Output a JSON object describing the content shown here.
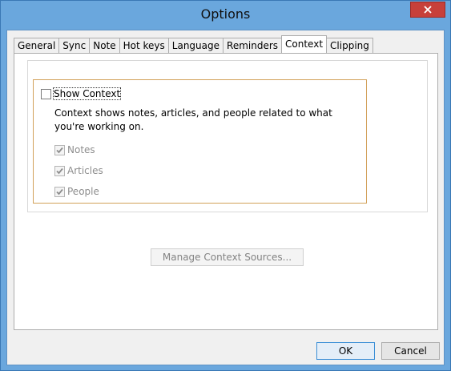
{
  "window": {
    "title": "Options"
  },
  "tabs": [
    {
      "label": "General"
    },
    {
      "label": "Sync"
    },
    {
      "label": "Note"
    },
    {
      "label": "Hot keys"
    },
    {
      "label": "Language"
    },
    {
      "label": "Reminders"
    },
    {
      "label": "Context"
    },
    {
      "label": "Clipping"
    }
  ],
  "active_tab": "Context",
  "context": {
    "show_context": {
      "label": "Show Context",
      "checked": false
    },
    "description": "Context shows notes, articles, and people related to what you're working on.",
    "sources": [
      {
        "label": "Notes",
        "checked": true,
        "enabled": false
      },
      {
        "label": "Articles",
        "checked": true,
        "enabled": false
      },
      {
        "label": "People",
        "checked": true,
        "enabled": false
      }
    ],
    "manage_label": "Manage Context Sources..."
  },
  "footer": {
    "ok_label": "OK",
    "cancel_label": "Cancel"
  },
  "icons": {
    "close": "close-icon",
    "check": "check-icon"
  }
}
